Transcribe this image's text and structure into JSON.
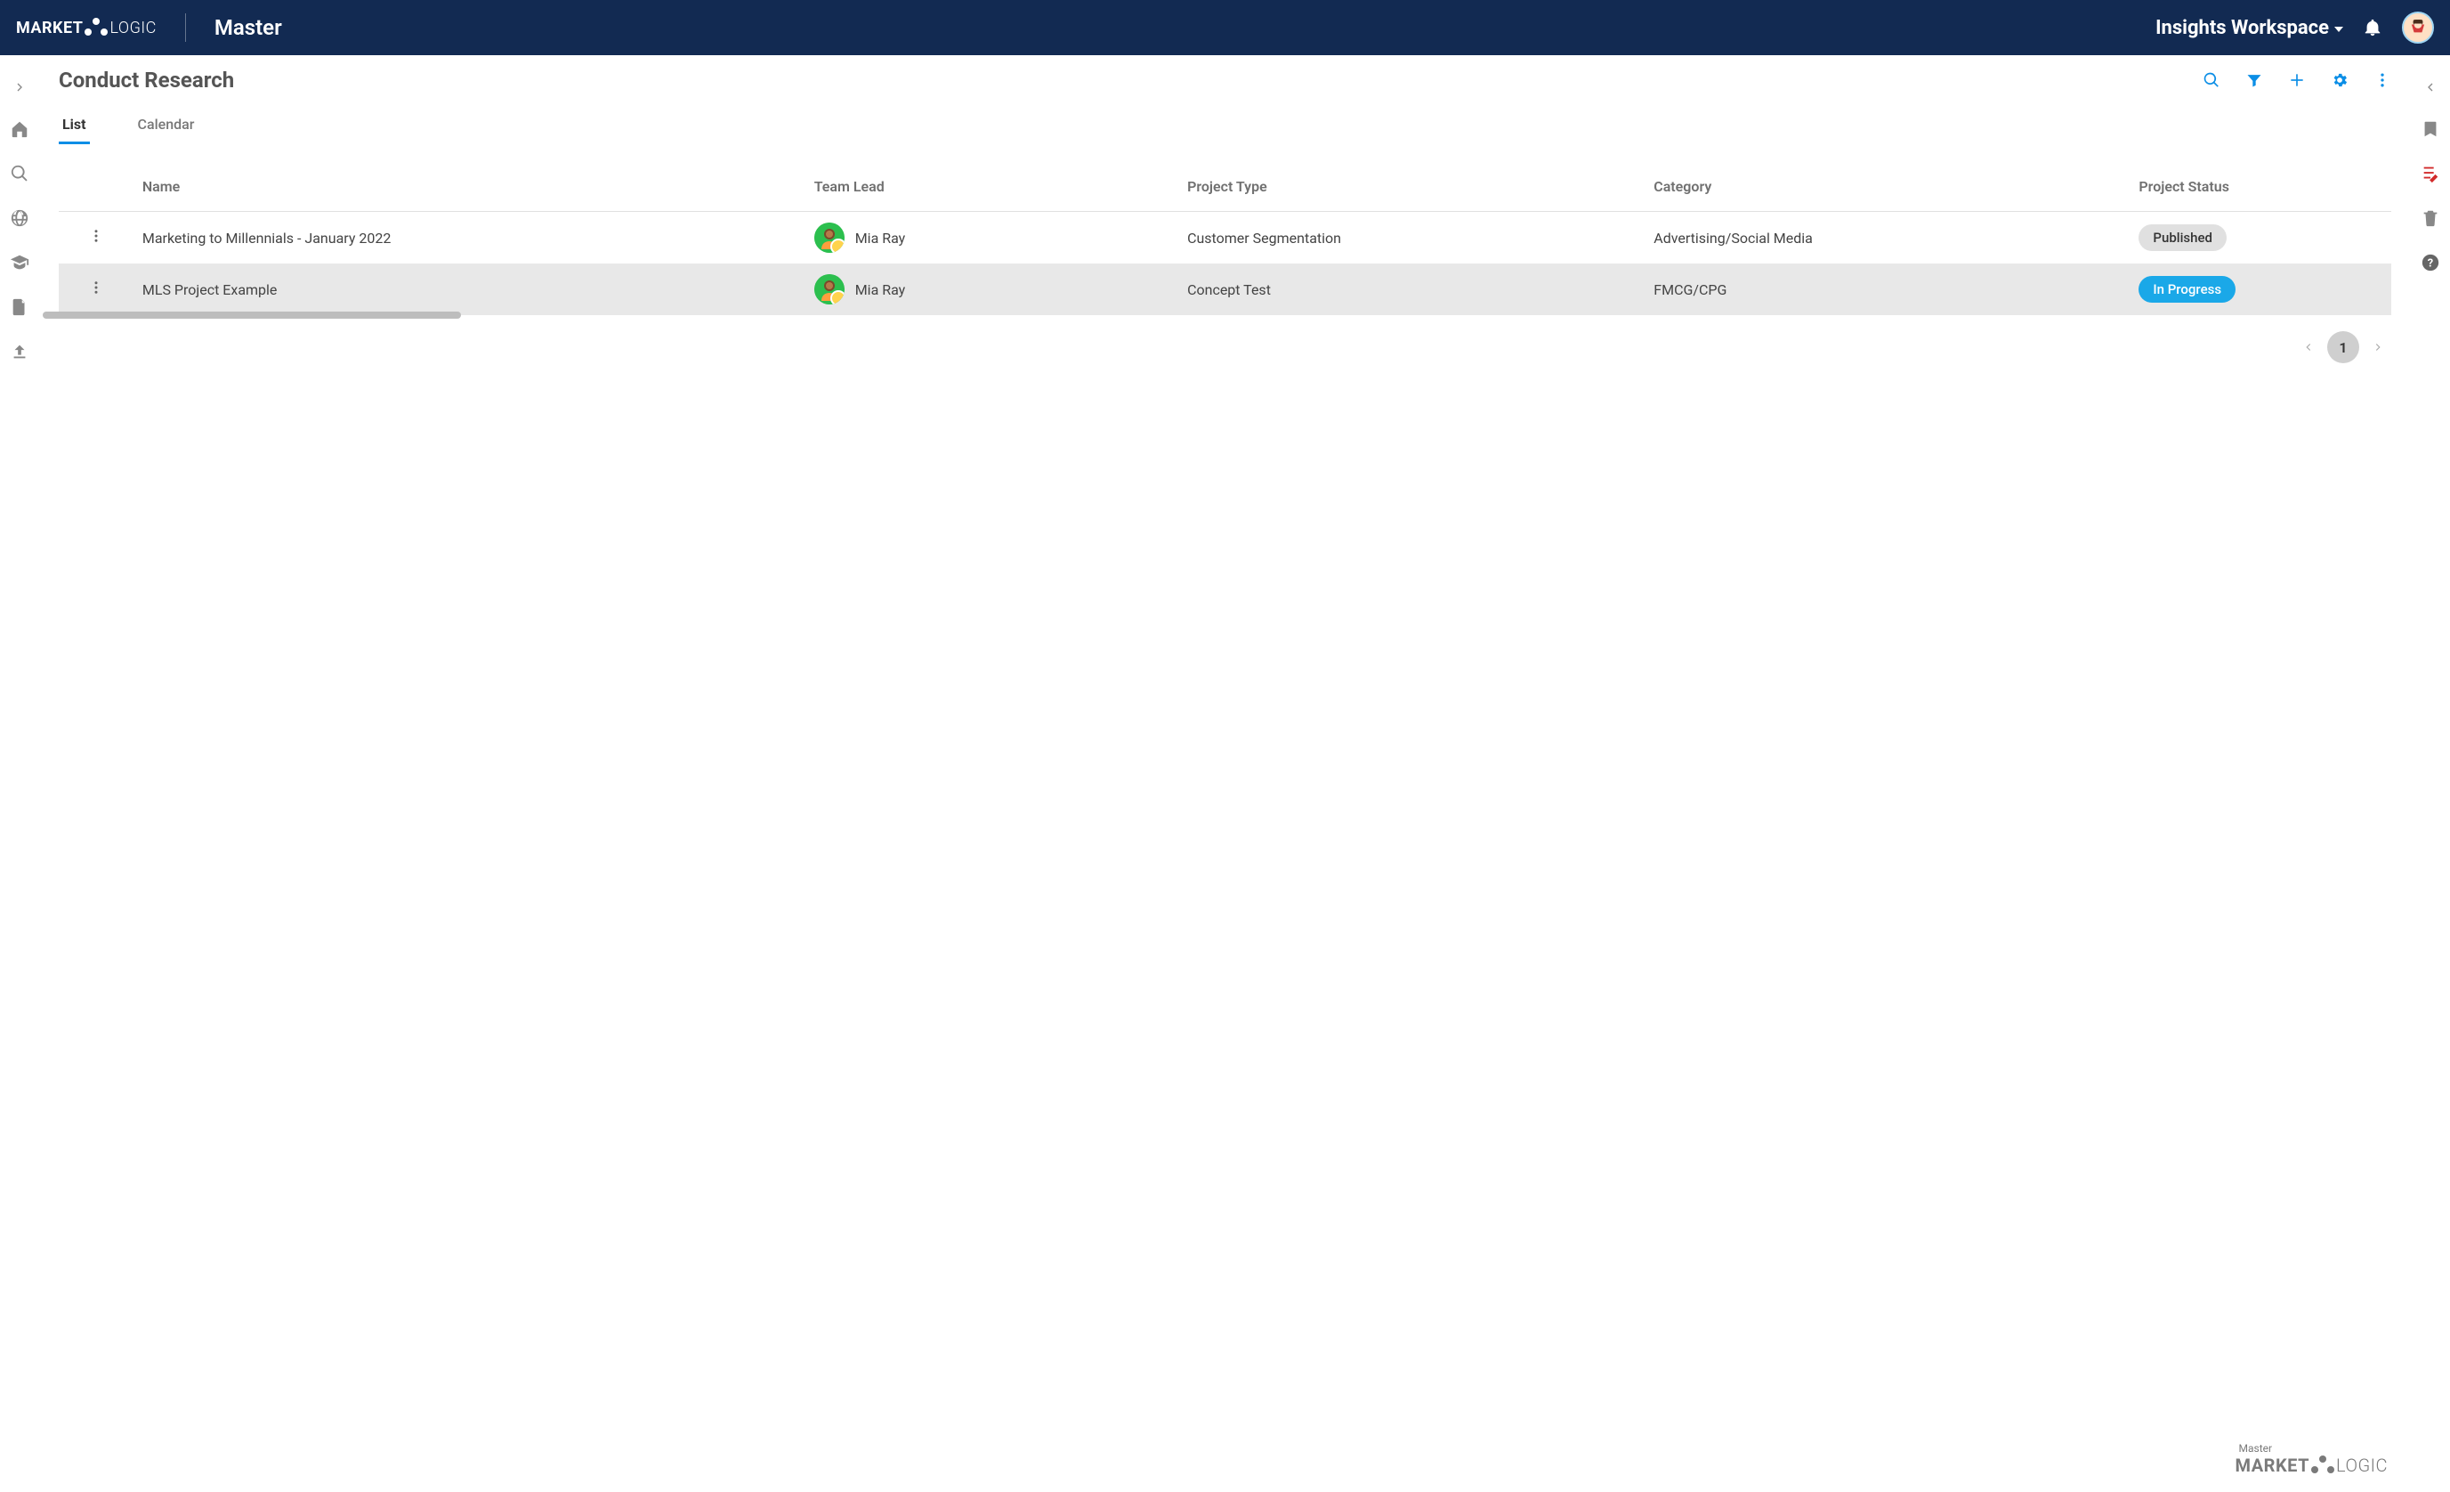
{
  "header": {
    "logo_brand_part1": "MARKET",
    "logo_brand_part2": "LOGIC",
    "workspace_name": "Master",
    "workspace_dropdown_label": "Insights Workspace"
  },
  "page": {
    "title": "Conduct Research",
    "tabs": [
      {
        "label": "List",
        "active": true
      },
      {
        "label": "Calendar",
        "active": false
      }
    ]
  },
  "table": {
    "columns": [
      "Name",
      "Team Lead",
      "Project Type",
      "Category",
      "Project Status"
    ],
    "rows": [
      {
        "name": "Marketing to Millennials - January 2022",
        "team_lead": "Mia Ray",
        "project_type": "Customer Segmentation",
        "category": "Advertising/Social Media",
        "status": {
          "label": "Published",
          "kind": "published"
        }
      },
      {
        "name": "MLS Project Example",
        "team_lead": "Mia Ray",
        "project_type": "Concept Test",
        "category": "FMCG/CPG",
        "status": {
          "label": "In Progress",
          "kind": "inprogress"
        }
      }
    ]
  },
  "pagination": {
    "current": "1"
  },
  "footer": {
    "small": "Master",
    "brand_part1": "MARKET",
    "brand_part2": "LOGIC"
  },
  "colors": {
    "accent_blue": "#0b8ee6",
    "header_bg": "#122a52",
    "status_inprogress_bg": "#1aa8e8",
    "status_published_bg": "#e0e0e0"
  }
}
